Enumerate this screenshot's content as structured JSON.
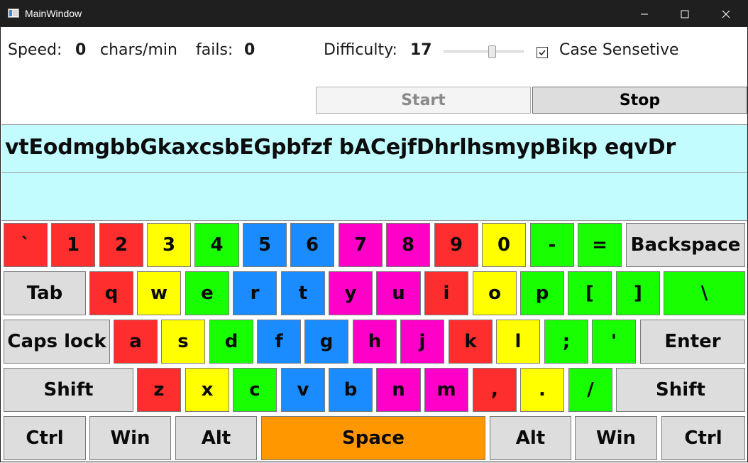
{
  "window": {
    "title": "MainWindow"
  },
  "stats": {
    "speed_label": "Speed:",
    "speed_value": "0",
    "speed_unit": "chars/min",
    "fails_label": "fails:",
    "fails_value": "0",
    "difficulty_label": "Difficulty:",
    "difficulty_value": "17",
    "difficulty_slider_level": 0.62,
    "case_label": "Case Sensetive",
    "case_checked": true
  },
  "buttons": {
    "start": "Start",
    "stop": "Stop"
  },
  "text": {
    "target": "vtEodmgbbGkaxcsbEGpbfzf bACejfDhrlhsmypBikp eqvDr",
    "typed": ""
  },
  "colors": {
    "red": "#ff2e2e",
    "yellow": "#ffff00",
    "green": "#17ff00",
    "blue": "#1b8cff",
    "magenta": "#ff00c8",
    "gray": "#dddddd",
    "orange": "#ff9800",
    "text_area_bg": "#c2fcff"
  },
  "keyboard": {
    "rows": [
      [
        {
          "label": "`",
          "color": "red"
        },
        {
          "label": "1",
          "color": "red"
        },
        {
          "label": "2",
          "color": "red"
        },
        {
          "label": "3",
          "color": "yellow"
        },
        {
          "label": "4",
          "color": "green"
        },
        {
          "label": "5",
          "color": "blue"
        },
        {
          "label": "6",
          "color": "blue"
        },
        {
          "label": "7",
          "color": "magenta"
        },
        {
          "label": "8",
          "color": "magenta"
        },
        {
          "label": "9",
          "color": "red"
        },
        {
          "label": "0",
          "color": "yellow"
        },
        {
          "label": "-",
          "color": "green"
        },
        {
          "label": "=",
          "color": "green"
        },
        {
          "label": "Backspace",
          "color": "gray"
        }
      ],
      [
        {
          "label": "Tab",
          "color": "gray"
        },
        {
          "label": "q",
          "color": "red"
        },
        {
          "label": "w",
          "color": "yellow"
        },
        {
          "label": "e",
          "color": "green"
        },
        {
          "label": "r",
          "color": "blue"
        },
        {
          "label": "t",
          "color": "blue"
        },
        {
          "label": "y",
          "color": "magenta"
        },
        {
          "label": "u",
          "color": "magenta"
        },
        {
          "label": "i",
          "color": "red"
        },
        {
          "label": "o",
          "color": "yellow"
        },
        {
          "label": "p",
          "color": "green"
        },
        {
          "label": "[",
          "color": "green"
        },
        {
          "label": "]",
          "color": "green"
        },
        {
          "label": "\\",
          "color": "green"
        }
      ],
      [
        {
          "label": "Caps lock",
          "color": "gray"
        },
        {
          "label": "a",
          "color": "red"
        },
        {
          "label": "s",
          "color": "yellow"
        },
        {
          "label": "d",
          "color": "green"
        },
        {
          "label": "f",
          "color": "blue"
        },
        {
          "label": "g",
          "color": "blue"
        },
        {
          "label": "h",
          "color": "magenta"
        },
        {
          "label": "j",
          "color": "magenta"
        },
        {
          "label": "k",
          "color": "red"
        },
        {
          "label": "l",
          "color": "yellow"
        },
        {
          "label": ";",
          "color": "green"
        },
        {
          "label": "'",
          "color": "green"
        },
        {
          "label": "Enter",
          "color": "gray"
        }
      ],
      [
        {
          "label": "Shift",
          "color": "gray"
        },
        {
          "label": "z",
          "color": "red"
        },
        {
          "label": "x",
          "color": "yellow"
        },
        {
          "label": "c",
          "color": "green"
        },
        {
          "label": "v",
          "color": "blue"
        },
        {
          "label": "b",
          "color": "blue"
        },
        {
          "label": "n",
          "color": "magenta"
        },
        {
          "label": "m",
          "color": "magenta"
        },
        {
          "label": ",",
          "color": "red"
        },
        {
          "label": ".",
          "color": "yellow"
        },
        {
          "label": "/",
          "color": "green"
        },
        {
          "label": "Shift",
          "color": "gray"
        }
      ],
      [
        {
          "label": "Ctrl",
          "color": "gray"
        },
        {
          "label": "Win",
          "color": "gray"
        },
        {
          "label": "Alt",
          "color": "gray"
        },
        {
          "label": "Space",
          "color": "orange"
        },
        {
          "label": "Alt",
          "color": "gray"
        },
        {
          "label": "Win",
          "color": "gray"
        },
        {
          "label": "Ctrl",
          "color": "gray"
        }
      ]
    ]
  }
}
